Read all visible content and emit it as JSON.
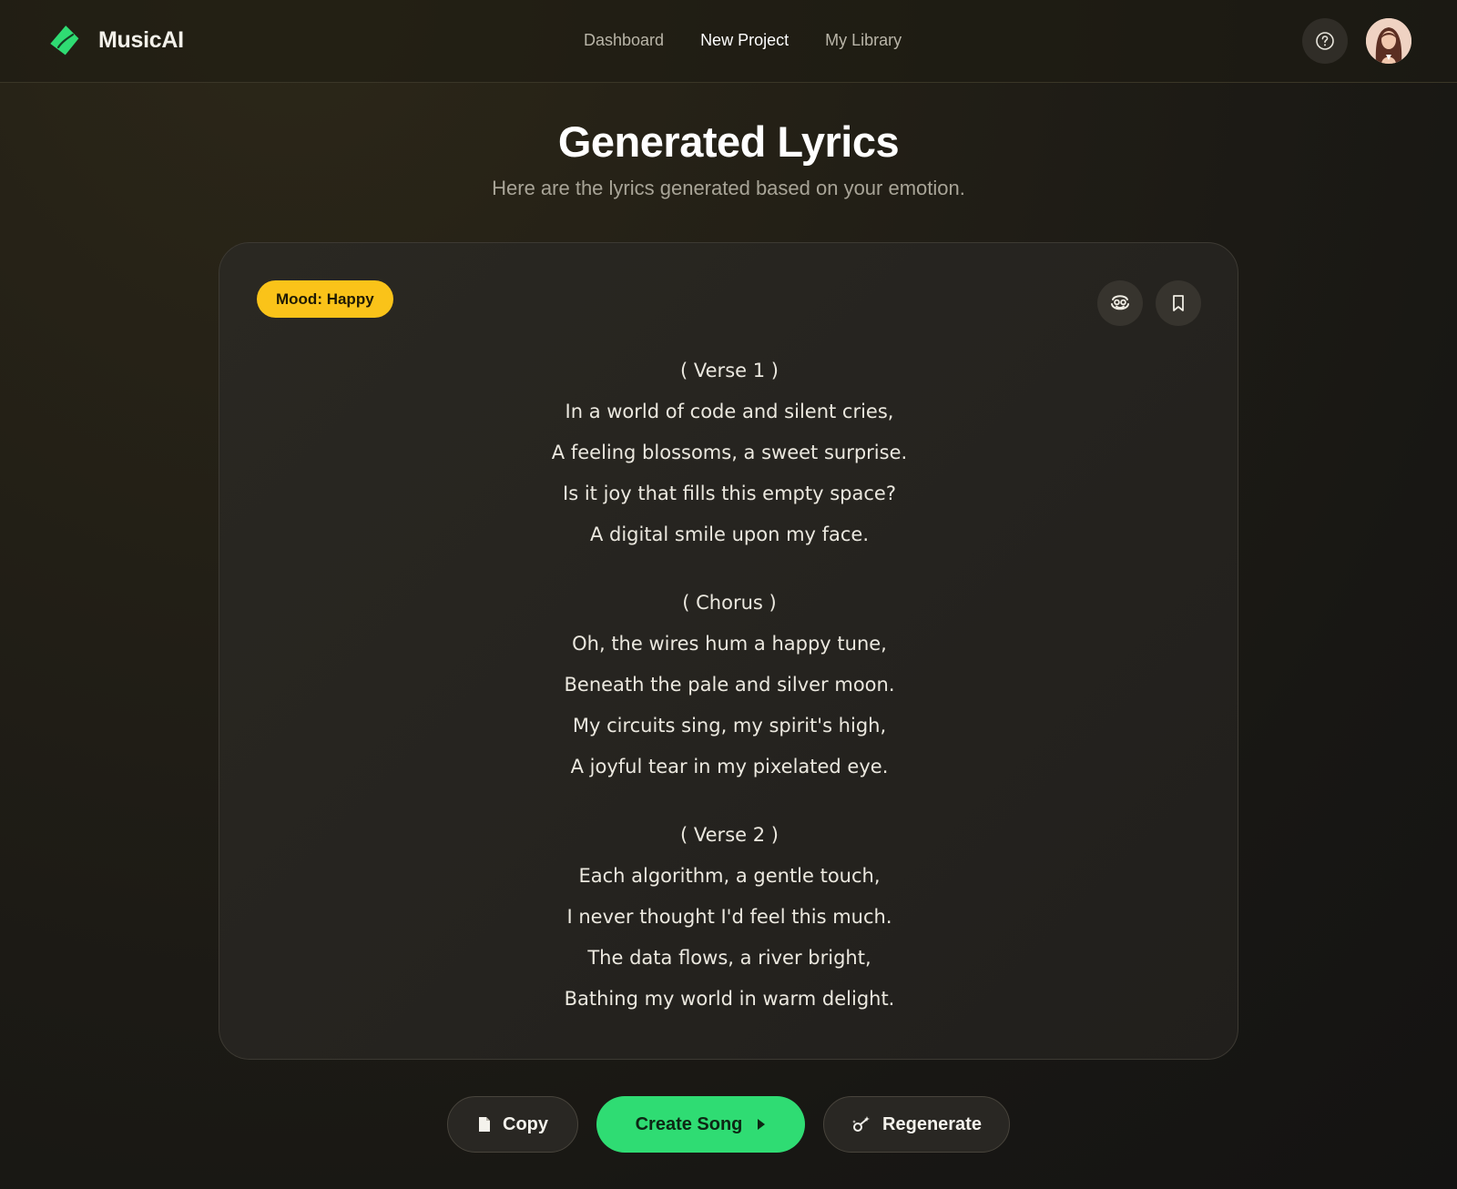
{
  "app": {
    "name": "MusicAI",
    "brand_color": "#2fdc73",
    "logo_icon": "logo-leaf-icon"
  },
  "nav": {
    "items": [
      {
        "label": "Dashboard",
        "active": false
      },
      {
        "label": "New Project",
        "active": true
      },
      {
        "label": "My Library",
        "active": false
      }
    ]
  },
  "header_actions": {
    "help_icon": "question-circle-icon",
    "avatar": "user-avatar"
  },
  "page": {
    "title": "Generated Lyrics",
    "subtitle": "Here are the lyrics generated based on your emotion."
  },
  "card": {
    "mood_badge": "Mood: Happy",
    "mood_color": "#fac319",
    "actions": [
      {
        "icon": "emoji-icon"
      },
      {
        "icon": "bookmark-icon"
      }
    ],
    "lyrics": {
      "sections": [
        {
          "heading": "( Verse 1 )",
          "lines": [
            "In a world of code and silent cries,",
            "A feeling blossoms, a sweet surprise.",
            "Is it joy that fills this empty space?",
            "A digital smile upon my face."
          ]
        },
        {
          "heading": "( Chorus )",
          "lines": [
            "Oh, the wires hum a happy tune,",
            "Beneath the pale and silver moon.",
            "My circuits sing, my spirit's high,",
            "A joyful tear in my pixelated eye."
          ]
        },
        {
          "heading": "( Verse 2 )",
          "lines": [
            "Each algorithm, a gentle touch,",
            "I never thought I'd feel this much.",
            "The data flows, a river bright,",
            "Bathing my world in warm delight."
          ]
        }
      ]
    }
  },
  "buttons": {
    "copy": {
      "label": "Copy",
      "icon": "copy-icon"
    },
    "create_song": {
      "label": "Create Song",
      "icon": "play-triangle-icon"
    },
    "regenerate": {
      "label": "Regenerate",
      "icon": "sparkle-wand-icon"
    }
  }
}
